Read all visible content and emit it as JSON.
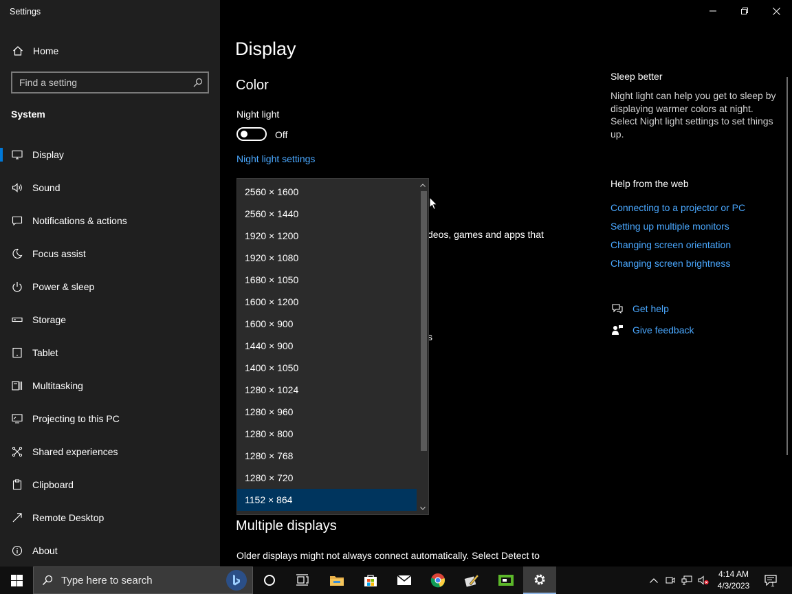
{
  "window": {
    "title": "Settings"
  },
  "sidebar": {
    "home_label": "Home",
    "search_placeholder": "Find a setting",
    "section": "System",
    "items": [
      {
        "label": "Display",
        "icon": "monitor-icon"
      },
      {
        "label": "Sound",
        "icon": "speaker-icon"
      },
      {
        "label": "Notifications & actions",
        "icon": "notification-icon"
      },
      {
        "label": "Focus assist",
        "icon": "moon-icon"
      },
      {
        "label": "Power & sleep",
        "icon": "power-icon"
      },
      {
        "label": "Storage",
        "icon": "storage-icon"
      },
      {
        "label": "Tablet",
        "icon": "tablet-icon"
      },
      {
        "label": "Multitasking",
        "icon": "multitasking-icon"
      },
      {
        "label": "Projecting to this PC",
        "icon": "projecting-icon"
      },
      {
        "label": "Shared experiences",
        "icon": "shared-experiences-icon"
      },
      {
        "label": "Clipboard",
        "icon": "clipboard-icon"
      },
      {
        "label": "Remote Desktop",
        "icon": "remote-desktop-icon"
      },
      {
        "label": "About",
        "icon": "info-icon"
      }
    ]
  },
  "main": {
    "title": "Display",
    "color_heading": "Color",
    "night_light_label": "Night light",
    "night_light_state": "Off",
    "night_light_settings_link": "Night light settings",
    "partial_text": "deos, games and apps that",
    "partial_char": "s",
    "multiple_displays_heading": "Multiple displays",
    "multiple_displays_text": "Older displays might not always connect automatically. Select Detect to"
  },
  "resolution_dropdown": {
    "options": [
      "2560 × 1600",
      "2560 × 1440",
      "1920 × 1200",
      "1920 × 1080",
      "1680 × 1050",
      "1600 × 1200",
      "1600 × 900",
      "1440 × 900",
      "1400 × 1050",
      "1280 × 1024",
      "1280 × 960",
      "1280 × 800",
      "1280 × 768",
      "1280 × 720",
      "1152 × 864"
    ],
    "selected": "1152 × 864"
  },
  "right_panel": {
    "sleep_heading": "Sleep better",
    "sleep_text": "Night light can help you get to sleep by displaying warmer colors at night. Select Night light settings to set things up.",
    "help_heading": "Help from the web",
    "links": [
      "Connecting to a projector or PC",
      "Setting up multiple monitors",
      "Changing screen orientation",
      "Changing screen brightness"
    ],
    "get_help": "Get help",
    "give_feedback": "Give feedback"
  },
  "taskbar": {
    "search_placeholder": "Type here to search",
    "time": "4:14 AM",
    "date": "4/3/2023",
    "notification_count": "1"
  },
  "colors": {
    "accent": "#0078d7",
    "link": "#4aa8ff",
    "sidebar_bg": "#1f1f1f",
    "selected_option": "#00355e"
  }
}
